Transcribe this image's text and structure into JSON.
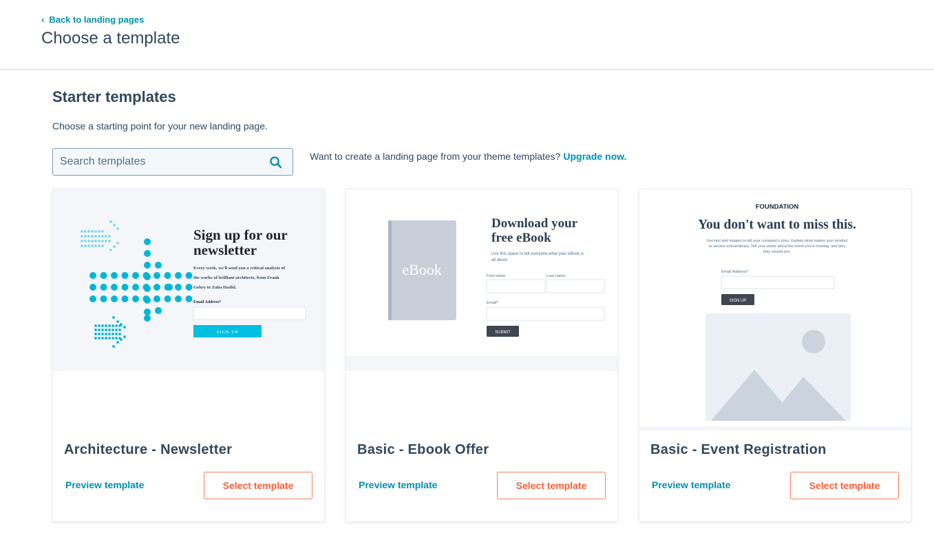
{
  "header": {
    "back_label": "Back to landing pages",
    "title": "Choose a template"
  },
  "section": {
    "title": "Starter templates",
    "subtitle": "Choose a starting point for your new landing page."
  },
  "search": {
    "placeholder": "Search templates",
    "value": ""
  },
  "upgrade": {
    "text": "Want to create a landing page from your theme templates? ",
    "link": "Upgrade now."
  },
  "colors": {
    "accent": "#0091ae",
    "cta": "#ff7a59",
    "text": "#33475b"
  },
  "cards": [
    {
      "title": "Architecture - Newsletter",
      "preview_label": "Preview template",
      "select_label": "Select template",
      "thumb": {
        "heading_line1": "Sign up for our",
        "heading_line2": "newsletter",
        "body_line1": "Every week, we'll send you a critical analysis of",
        "body_line2": "the works of brilliant architects, from Frank",
        "body_line3": "Gehry to Zaha Hadid.",
        "email_label": "Email Address*",
        "button": "SIGN UP"
      }
    },
    {
      "title": "Basic - Ebook Offer",
      "preview_label": "Preview template",
      "select_label": "Select template",
      "thumb": {
        "book_label": "eBook",
        "heading_line1": "Download your",
        "heading_line2": "free eBook",
        "body_line1": "Use this space to tell everyone what your eBook is",
        "body_line2": "all about.",
        "first_name": "First name",
        "last_name": "Last name",
        "email_label": "Email*",
        "button": "SUBMIT"
      }
    },
    {
      "title": "Basic - Event Registration",
      "preview_label": "Preview template",
      "select_label": "Select template",
      "thumb": {
        "brand": "FOUNDATION",
        "heading": "You don't want to miss this.",
        "body_line1": "Use text and images to tell your company's story. Explain what makes your product",
        "body_line2": "or service extraordinary. Tell your visitor about the event you're hosting, and why",
        "body_line3": "they should join.",
        "email_label": "Email Address*",
        "button": "SIGN UP"
      }
    }
  ]
}
